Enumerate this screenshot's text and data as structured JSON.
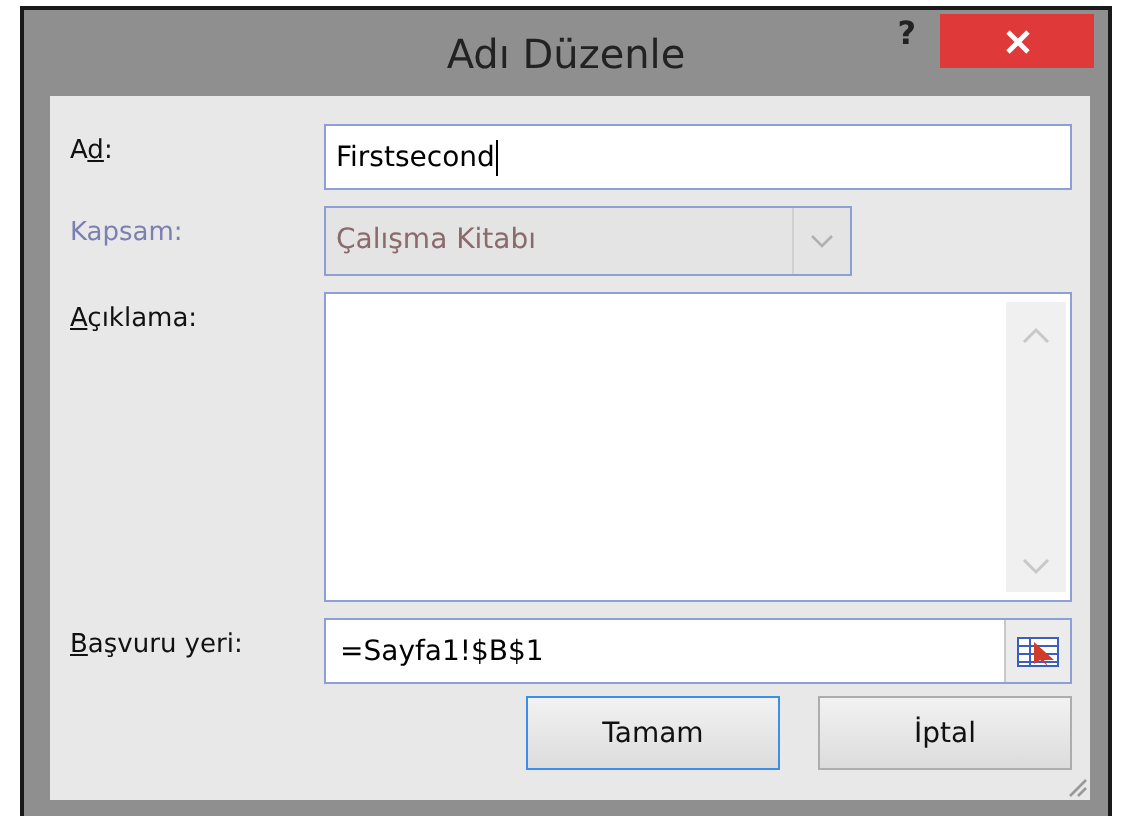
{
  "window": {
    "title": "Adı Düzenle",
    "help": "?"
  },
  "fields": [
    {
      "kind": "text",
      "label_pre": "A",
      "access_key": "d",
      "label_post": ":",
      "value": "Firstsecond",
      "disabled": false
    },
    {
      "kind": "combo",
      "label_post": "Kapsam:",
      "value": "Çalışma Kitabı",
      "disabled": true
    },
    {
      "kind": "textarea",
      "access_key": "A",
      "label_post": "çıklama:",
      "disabled": false
    },
    {
      "kind": "reference",
      "access_key": "B",
      "label_post": "aşvuru yeri:",
      "value": "=Sayfa1!$B$1",
      "disabled": false
    }
  ],
  "buttons": [
    {
      "label": "Tamam",
      "selected": true
    },
    {
      "label": "İptal",
      "selected": false
    }
  ]
}
